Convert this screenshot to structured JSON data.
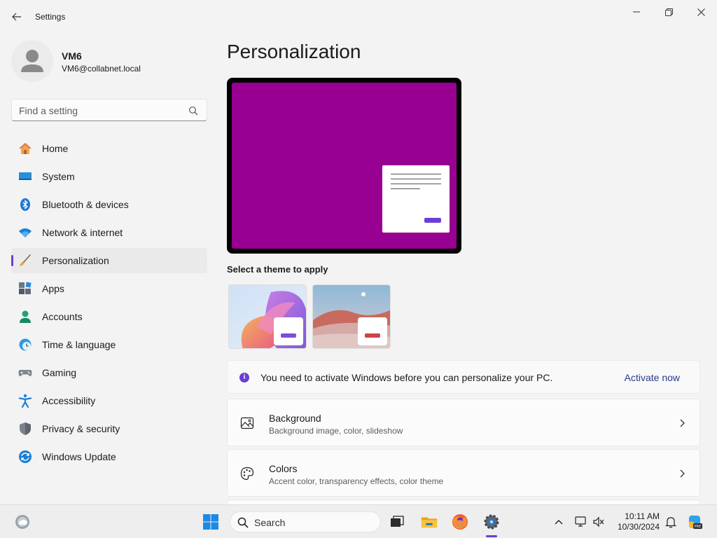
{
  "window": {
    "title": "Settings"
  },
  "user": {
    "name": "VM6",
    "email": "VM6@collabnet.local"
  },
  "search": {
    "placeholder": "Find a setting"
  },
  "nav": [
    {
      "label": "Home",
      "icon": "home-icon"
    },
    {
      "label": "System",
      "icon": "system-icon"
    },
    {
      "label": "Bluetooth & devices",
      "icon": "bluetooth-icon"
    },
    {
      "label": "Network & internet",
      "icon": "wifi-icon"
    },
    {
      "label": "Personalization",
      "icon": "brush-icon",
      "selected": true
    },
    {
      "label": "Apps",
      "icon": "apps-icon"
    },
    {
      "label": "Accounts",
      "icon": "accounts-icon"
    },
    {
      "label": "Time & language",
      "icon": "clock-globe-icon"
    },
    {
      "label": "Gaming",
      "icon": "gamepad-icon"
    },
    {
      "label": "Accessibility",
      "icon": "accessibility-icon"
    },
    {
      "label": "Privacy & security",
      "icon": "shield-icon"
    },
    {
      "label": "Windows Update",
      "icon": "update-icon"
    }
  ],
  "main": {
    "title": "Personalization",
    "theme_heading": "Select a theme to apply",
    "themes": [
      {
        "name": "bloom-theme",
        "accent": "#7c4ed8"
      },
      {
        "name": "desert-theme",
        "accent": "#c9454a"
      }
    ],
    "banner": {
      "text": "You need to activate Windows before you can personalize your PC.",
      "link": "Activate now"
    },
    "rows": [
      {
        "title": "Background",
        "subtitle": "Background image, color, slideshow",
        "icon": "image-icon"
      },
      {
        "title": "Colors",
        "subtitle": "Accent color, transparency effects, color theme",
        "icon": "palette-icon"
      }
    ]
  },
  "taskbar": {
    "search_label": "Search",
    "time": "10:11 AM",
    "date": "10/30/2024"
  },
  "colors": {
    "accent": "#6b3fd1",
    "preview_background": "#970090"
  }
}
